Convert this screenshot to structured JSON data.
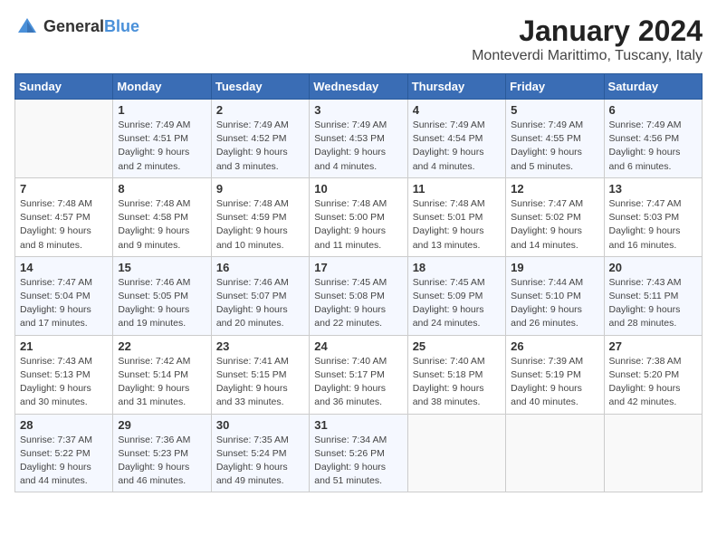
{
  "logo": {
    "general": "General",
    "blue": "Blue"
  },
  "title": "January 2024",
  "subtitle": "Monteverdi Marittimo, Tuscany, Italy",
  "days_header": [
    "Sunday",
    "Monday",
    "Tuesday",
    "Wednesday",
    "Thursday",
    "Friday",
    "Saturday"
  ],
  "weeks": [
    [
      {
        "day": "",
        "info": ""
      },
      {
        "day": "1",
        "info": "Sunrise: 7:49 AM\nSunset: 4:51 PM\nDaylight: 9 hours\nand 2 minutes."
      },
      {
        "day": "2",
        "info": "Sunrise: 7:49 AM\nSunset: 4:52 PM\nDaylight: 9 hours\nand 3 minutes."
      },
      {
        "day": "3",
        "info": "Sunrise: 7:49 AM\nSunset: 4:53 PM\nDaylight: 9 hours\nand 4 minutes."
      },
      {
        "day": "4",
        "info": "Sunrise: 7:49 AM\nSunset: 4:54 PM\nDaylight: 9 hours\nand 4 minutes."
      },
      {
        "day": "5",
        "info": "Sunrise: 7:49 AM\nSunset: 4:55 PM\nDaylight: 9 hours\nand 5 minutes."
      },
      {
        "day": "6",
        "info": "Sunrise: 7:49 AM\nSunset: 4:56 PM\nDaylight: 9 hours\nand 6 minutes."
      }
    ],
    [
      {
        "day": "7",
        "info": "Sunrise: 7:48 AM\nSunset: 4:57 PM\nDaylight: 9 hours\nand 8 minutes."
      },
      {
        "day": "8",
        "info": "Sunrise: 7:48 AM\nSunset: 4:58 PM\nDaylight: 9 hours\nand 9 minutes."
      },
      {
        "day": "9",
        "info": "Sunrise: 7:48 AM\nSunset: 4:59 PM\nDaylight: 9 hours\nand 10 minutes."
      },
      {
        "day": "10",
        "info": "Sunrise: 7:48 AM\nSunset: 5:00 PM\nDaylight: 9 hours\nand 11 minutes."
      },
      {
        "day": "11",
        "info": "Sunrise: 7:48 AM\nSunset: 5:01 PM\nDaylight: 9 hours\nand 13 minutes."
      },
      {
        "day": "12",
        "info": "Sunrise: 7:47 AM\nSunset: 5:02 PM\nDaylight: 9 hours\nand 14 minutes."
      },
      {
        "day": "13",
        "info": "Sunrise: 7:47 AM\nSunset: 5:03 PM\nDaylight: 9 hours\nand 16 minutes."
      }
    ],
    [
      {
        "day": "14",
        "info": "Sunrise: 7:47 AM\nSunset: 5:04 PM\nDaylight: 9 hours\nand 17 minutes."
      },
      {
        "day": "15",
        "info": "Sunrise: 7:46 AM\nSunset: 5:05 PM\nDaylight: 9 hours\nand 19 minutes."
      },
      {
        "day": "16",
        "info": "Sunrise: 7:46 AM\nSunset: 5:07 PM\nDaylight: 9 hours\nand 20 minutes."
      },
      {
        "day": "17",
        "info": "Sunrise: 7:45 AM\nSunset: 5:08 PM\nDaylight: 9 hours\nand 22 minutes."
      },
      {
        "day": "18",
        "info": "Sunrise: 7:45 AM\nSunset: 5:09 PM\nDaylight: 9 hours\nand 24 minutes."
      },
      {
        "day": "19",
        "info": "Sunrise: 7:44 AM\nSunset: 5:10 PM\nDaylight: 9 hours\nand 26 minutes."
      },
      {
        "day": "20",
        "info": "Sunrise: 7:43 AM\nSunset: 5:11 PM\nDaylight: 9 hours\nand 28 minutes."
      }
    ],
    [
      {
        "day": "21",
        "info": "Sunrise: 7:43 AM\nSunset: 5:13 PM\nDaylight: 9 hours\nand 30 minutes."
      },
      {
        "day": "22",
        "info": "Sunrise: 7:42 AM\nSunset: 5:14 PM\nDaylight: 9 hours\nand 31 minutes."
      },
      {
        "day": "23",
        "info": "Sunrise: 7:41 AM\nSunset: 5:15 PM\nDaylight: 9 hours\nand 33 minutes."
      },
      {
        "day": "24",
        "info": "Sunrise: 7:40 AM\nSunset: 5:17 PM\nDaylight: 9 hours\nand 36 minutes."
      },
      {
        "day": "25",
        "info": "Sunrise: 7:40 AM\nSunset: 5:18 PM\nDaylight: 9 hours\nand 38 minutes."
      },
      {
        "day": "26",
        "info": "Sunrise: 7:39 AM\nSunset: 5:19 PM\nDaylight: 9 hours\nand 40 minutes."
      },
      {
        "day": "27",
        "info": "Sunrise: 7:38 AM\nSunset: 5:20 PM\nDaylight: 9 hours\nand 42 minutes."
      }
    ],
    [
      {
        "day": "28",
        "info": "Sunrise: 7:37 AM\nSunset: 5:22 PM\nDaylight: 9 hours\nand 44 minutes."
      },
      {
        "day": "29",
        "info": "Sunrise: 7:36 AM\nSunset: 5:23 PM\nDaylight: 9 hours\nand 46 minutes."
      },
      {
        "day": "30",
        "info": "Sunrise: 7:35 AM\nSunset: 5:24 PM\nDaylight: 9 hours\nand 49 minutes."
      },
      {
        "day": "31",
        "info": "Sunrise: 7:34 AM\nSunset: 5:26 PM\nDaylight: 9 hours\nand 51 minutes."
      },
      {
        "day": "",
        "info": ""
      },
      {
        "day": "",
        "info": ""
      },
      {
        "day": "",
        "info": ""
      }
    ]
  ]
}
